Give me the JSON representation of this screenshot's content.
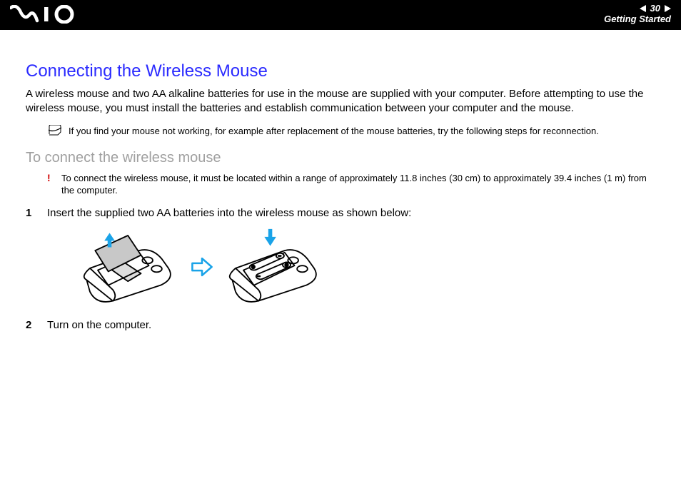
{
  "header": {
    "page_number": "30",
    "section": "Getting Started"
  },
  "title": "Connecting the Wireless Mouse",
  "intro": "A wireless mouse and two AA alkaline batteries for use in the mouse are supplied with your computer. Before attempting to use the wireless mouse, you must install the batteries and establish communication between your computer and the mouse.",
  "note": "If you find your mouse not working, for example after replacement of the mouse batteries, try the following steps for reconnection.",
  "subheading": "To connect the wireless mouse",
  "warning_mark": "!",
  "warning": "To connect the wireless mouse, it must be located within a range of approximately 11.8 inches (30 cm) to approximately 39.4 inches (1 m) from the computer.",
  "steps": [
    "Insert the supplied two AA batteries into the wireless mouse as shown below:",
    "Turn on the computer."
  ]
}
